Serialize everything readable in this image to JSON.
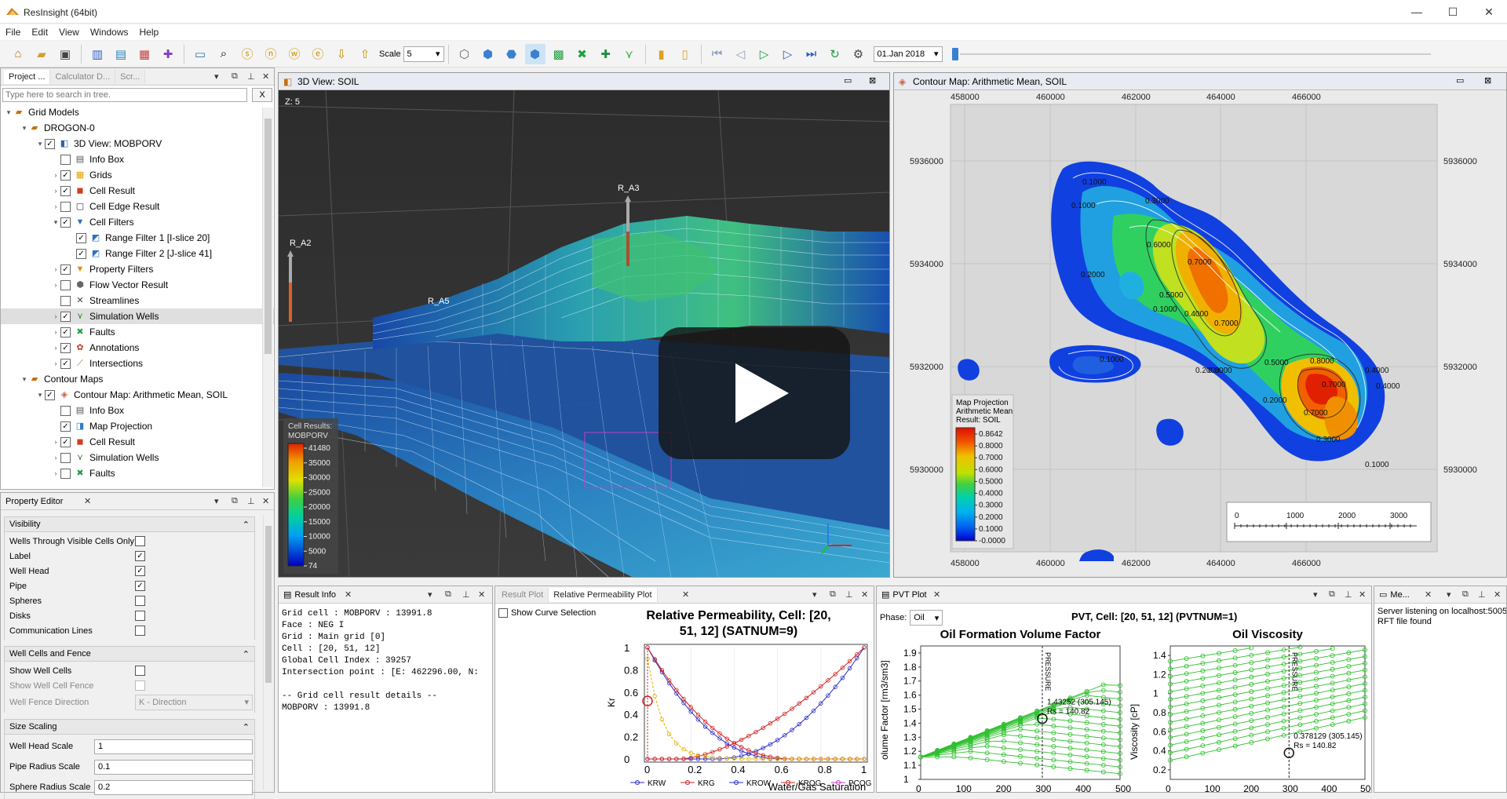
{
  "app": {
    "title": "ResInsight (64bit)"
  },
  "menu": [
    "File",
    "Edit",
    "View",
    "Windows",
    "Help"
  ],
  "toolbar": {
    "scale_label": "Scale",
    "scale_value": "5",
    "date_value": "01.Jan 2018"
  },
  "project_tree": {
    "tabs": [
      "Project ...",
      "Calculator D...",
      "Scr..."
    ],
    "search_placeholder": "Type here to search in tree.",
    "clear_label": "X",
    "items": [
      {
        "label": "Grid Models",
        "checked": null,
        "icon": "folder-icon"
      },
      {
        "label": "DROGON-0",
        "checked": null,
        "icon": "grid-case-icon"
      },
      {
        "label": "3D View: MOBPORV",
        "checked": true,
        "icon": "view-icon"
      },
      {
        "label": "Info Box",
        "checked": false,
        "icon": "info-box-icon"
      },
      {
        "label": "Grids",
        "checked": true,
        "icon": "grids-icon"
      },
      {
        "label": "Cell Result",
        "checked": true,
        "icon": "cell-result-icon"
      },
      {
        "label": "Cell Edge Result",
        "checked": false,
        "icon": "cell-edge-icon"
      },
      {
        "label": "Cell Filters",
        "checked": true,
        "icon": "filter-icon"
      },
      {
        "label": "Range Filter 1 [I-slice 20]",
        "checked": true,
        "icon": "range-filter-icon"
      },
      {
        "label": "Range Filter 2 [J-slice 41]",
        "checked": true,
        "icon": "range-filter-icon"
      },
      {
        "label": "Property Filters",
        "checked": true,
        "icon": "property-filter-icon"
      },
      {
        "label": "Flow Vector Result",
        "checked": false,
        "icon": "flow-vector-icon"
      },
      {
        "label": "Streamlines",
        "checked": false,
        "icon": "streamlines-icon"
      },
      {
        "label": "Simulation Wells",
        "checked": true,
        "icon": "wells-icon"
      },
      {
        "label": "Faults",
        "checked": true,
        "icon": "faults-icon"
      },
      {
        "label": "Annotations",
        "checked": true,
        "icon": "annotations-icon"
      },
      {
        "label": "Intersections",
        "checked": true,
        "icon": "intersections-icon"
      },
      {
        "label": "Contour Maps",
        "checked": null,
        "icon": "folder-icon"
      },
      {
        "label": "Contour Map: Arithmetic Mean, SOIL",
        "checked": true,
        "icon": "contour-map-icon"
      },
      {
        "label": "Info Box",
        "checked": false,
        "icon": "info-box-icon"
      },
      {
        "label": "Map Projection",
        "checked": true,
        "icon": "map-projection-icon"
      },
      {
        "label": "Cell Result",
        "checked": true,
        "icon": "cell-result-icon"
      },
      {
        "label": "Simulation Wells",
        "checked": false,
        "icon": "wells-icon"
      },
      {
        "label": "Faults",
        "checked": false,
        "icon": "faults-icon"
      }
    ]
  },
  "property_editor": {
    "title": "Property Editor",
    "groups": {
      "visibility": {
        "title": "Visibility",
        "rows": [
          {
            "label": "Wells Through Visible Cells Only",
            "checked": false
          },
          {
            "label": "Label",
            "checked": true
          },
          {
            "label": "Well Head",
            "checked": true
          },
          {
            "label": "Pipe",
            "checked": true
          },
          {
            "label": "Spheres",
            "checked": false
          },
          {
            "label": "Disks",
            "checked": false
          },
          {
            "label": "Communication Lines",
            "checked": false
          }
        ]
      },
      "wellcells": {
        "title": "Well Cells and Fence",
        "rows": [
          {
            "label": "Show Well Cells",
            "checked": false
          },
          {
            "label": "Show Well Cell Fence",
            "checked": false
          }
        ],
        "fence_label": "Well Fence Direction",
        "fence_value": "K - Direction"
      },
      "sizescaling": {
        "title": "Size Scaling",
        "rows": [
          {
            "label": "Well Head Scale",
            "value": "1"
          },
          {
            "label": "Pipe Radius Scale",
            "value": "0.1"
          },
          {
            "label": "Sphere Radius Scale",
            "value": "0.2"
          }
        ]
      }
    }
  },
  "view3d": {
    "title": "3D View: SOIL",
    "z_label": "Z: 5",
    "wells": [
      "R_A3",
      "R_A2",
      "R_A5"
    ],
    "legend": {
      "title": "Cell Results:",
      "result": "MOBPORV",
      "values": [
        "41480",
        "35000",
        "30000",
        "25000",
        "20000",
        "15000",
        "10000",
        "5000",
        "74"
      ]
    }
  },
  "contour": {
    "title": "Contour Map: Arithmetic Mean, SOIL",
    "x_ticks": [
      "458000",
      "460000",
      "462000",
      "464000",
      "466000"
    ],
    "y_ticks": [
      "5936000",
      "5934000",
      "5932000",
      "5930000"
    ],
    "legend": {
      "line1": "Map Projection",
      "line2": "Arithmetic Mean",
      "line3": "Result: SOIL",
      "values": [
        "0.8642",
        "0.8000",
        "0.7000",
        "0.6000",
        "0.5000",
        "0.4000",
        "0.3000",
        "0.2000",
        "0.1000",
        "-0.0000"
      ]
    },
    "scale_bar": [
      "0",
      "1000",
      "2000",
      "3000"
    ],
    "contour_labels": [
      "0.1000",
      "0.1000",
      "0.3000",
      "0.2000",
      "0.7000",
      "0.6000",
      "0.5000",
      "0.4000",
      "0.7000",
      "0.1000",
      "0.1000",
      "0.8000",
      "0.7000",
      "0.2000",
      "0.3000",
      "0.4000",
      "0.2000",
      "0.7000",
      "0.3000",
      "0.5000",
      "0.4000",
      "0.1000"
    ]
  },
  "result_info": {
    "title": "Result Info",
    "text": "Grid cell : MOBPORV : 13991.8\nFace : NEG I\nGrid : Main grid [0]\nCell : [20, 51, 12]\nGlobal Cell Index : 39257\nIntersection point : [E: 462296.00, N:\n\n-- Grid cell result details --\nMOBPORV : 13991.8"
  },
  "relperm": {
    "tabs": [
      "Result Plot",
      "Relative Permeability Plot"
    ],
    "show_curve_selection": "Show Curve Selection",
    "title": "Relative Permeability, Cell: [20, 51, 12] (SATNUM=9)",
    "ylabel": "Kr",
    "xlabel": "Water/Gas Saturation",
    "x_ticks": [
      "0",
      "0.2",
      "0.4",
      "0.6",
      "0.8",
      "1"
    ],
    "y_ticks": [
      "0",
      "0.2",
      "0.4",
      "0.6",
      "0.8",
      "1"
    ],
    "legend": [
      "KRW",
      "KRG",
      "KROW",
      "KROG",
      "PCOG"
    ],
    "colors": {
      "KRW": "#2a2ad0",
      "KRG": "#d02020",
      "KROW": "#2a2ad0",
      "KROG": "#d02020",
      "PCOG": "#c040c0",
      "SOIL": "#e0b000"
    }
  },
  "pvt": {
    "tab": "PVT Plot",
    "phase_label": "Phase:",
    "phase_value": "Oil",
    "title": "PVT, Cell: [20, 51, 12] (PVTNUM=1)",
    "fvf": {
      "title": "Oil  Formation Volume Factor",
      "ylabel": "olume Factor [rm3/sm3]",
      "y_ticks": [
        "1",
        "1.1",
        "1.2",
        "1.3",
        "1.4",
        "1.5",
        "1.6",
        "1.7",
        "1.8",
        "1.9"
      ],
      "x_ticks": [
        "0",
        "100",
        "200",
        "300",
        "400",
        "500"
      ],
      "annotation1": "1.43252 (305.145)",
      "annotation2": "Rs = 140.82",
      "pressure": "PRESSURE"
    },
    "visc": {
      "title": "Oil  Viscosity",
      "ylabel": "Viscosity [cP]",
      "y_ticks": [
        "0.2",
        "0.4",
        "0.6",
        "0.8",
        "1",
        "1.2",
        "1.4"
      ],
      "x_ticks": [
        "0",
        "100",
        "200",
        "300",
        "400",
        "500"
      ],
      "annotation1": "0.378129 (305.145)",
      "annotation2": "Rs = 140.82",
      "pressure": "PRESSURE"
    }
  },
  "messages": {
    "tab": "Me...",
    "lines": [
      "Server listening on localhost:50053",
      "RFT file found"
    ]
  }
}
